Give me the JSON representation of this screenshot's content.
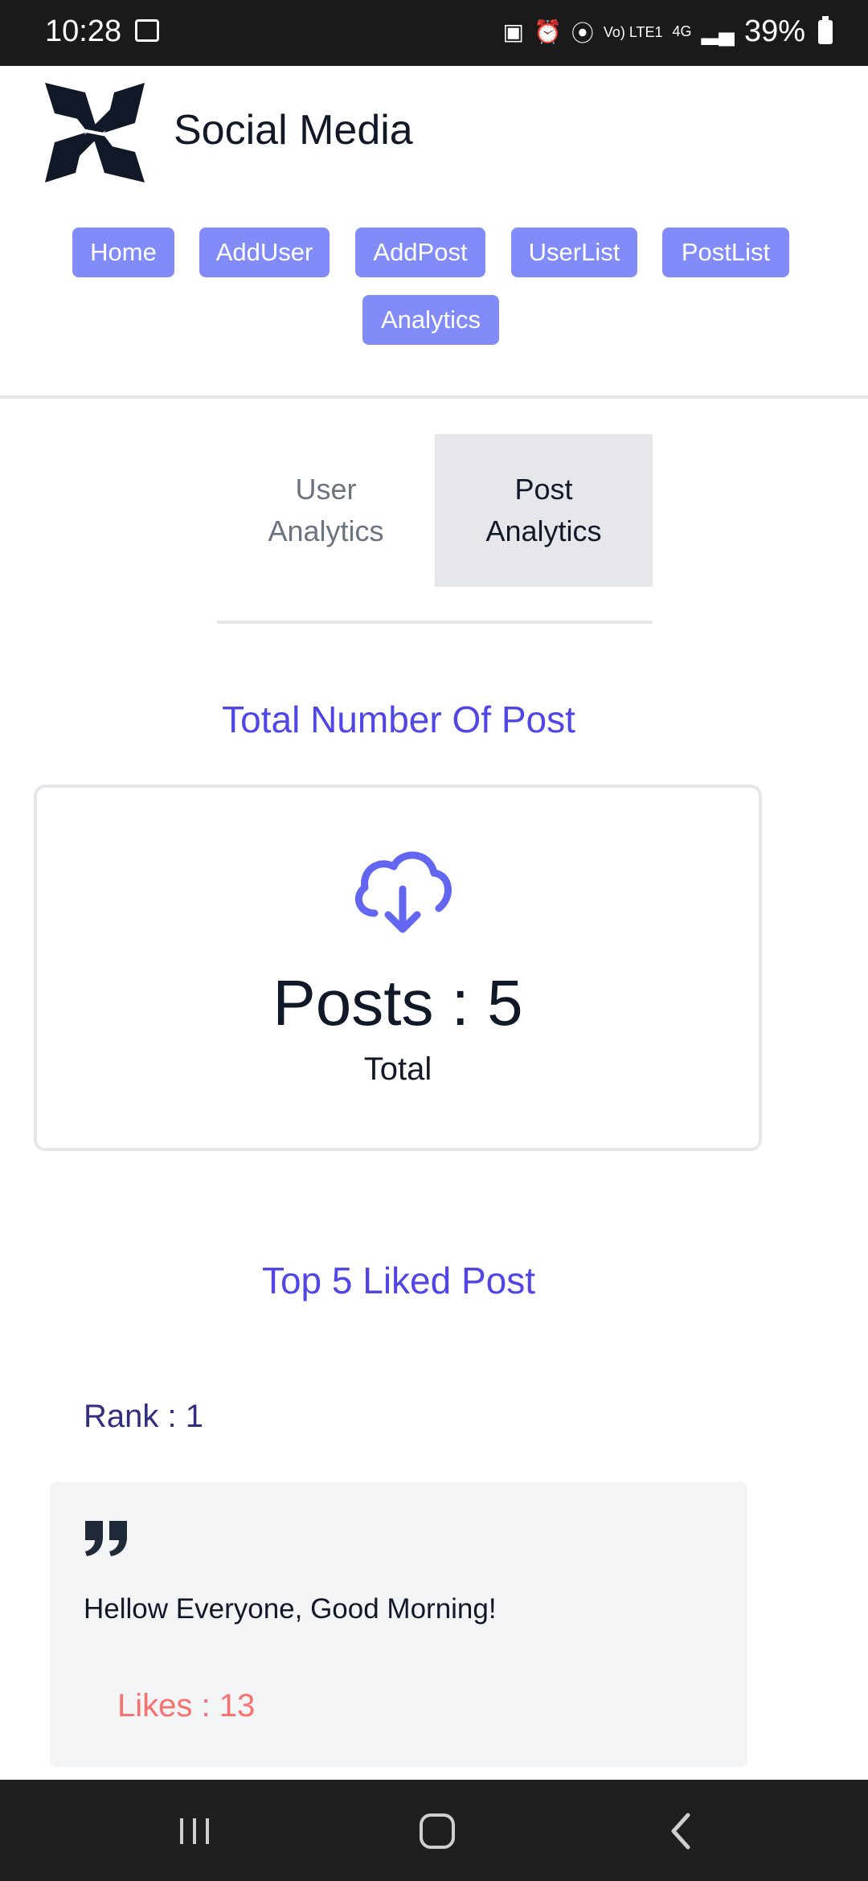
{
  "status_bar": {
    "time": "10:28",
    "signal_text": "Vo) LTE1",
    "network": "4G",
    "battery": "39%",
    "icons": [
      "gallery-icon",
      "lock-icon",
      "alarm-icon",
      "hotspot-icon",
      "signal-icon",
      "battery-icon"
    ]
  },
  "header": {
    "brand": "Social Media",
    "logo": "x-logo-icon"
  },
  "nav": {
    "items": [
      {
        "label": "Home"
      },
      {
        "label": "AddUser"
      },
      {
        "label": "AddPost"
      },
      {
        "label": "UserList"
      },
      {
        "label": "PostList"
      },
      {
        "label": "Analytics"
      }
    ]
  },
  "tabs": {
    "user_line1": "User",
    "user_line2": "Analytics",
    "post_line1": "Post",
    "post_line2": "Analytics",
    "active": "Post Analytics"
  },
  "total_section": {
    "title": "Total Number Of Post",
    "count_label": "Posts : 5",
    "sub_label": "Total",
    "icon": "cloud-download-icon"
  },
  "top_section": {
    "title": "Top 5 Liked Post",
    "posts": [
      {
        "rank": "Rank : 1",
        "text": "Hellow Everyone, Good Morning!",
        "likes": "Likes : 13"
      }
    ]
  },
  "colors": {
    "accent": "#4f46e5",
    "nav_button": "#818cf8",
    "likes": "#f87171",
    "rank": "#312e81"
  },
  "system_nav": [
    "recent-apps-icon",
    "home-icon",
    "back-icon"
  ]
}
